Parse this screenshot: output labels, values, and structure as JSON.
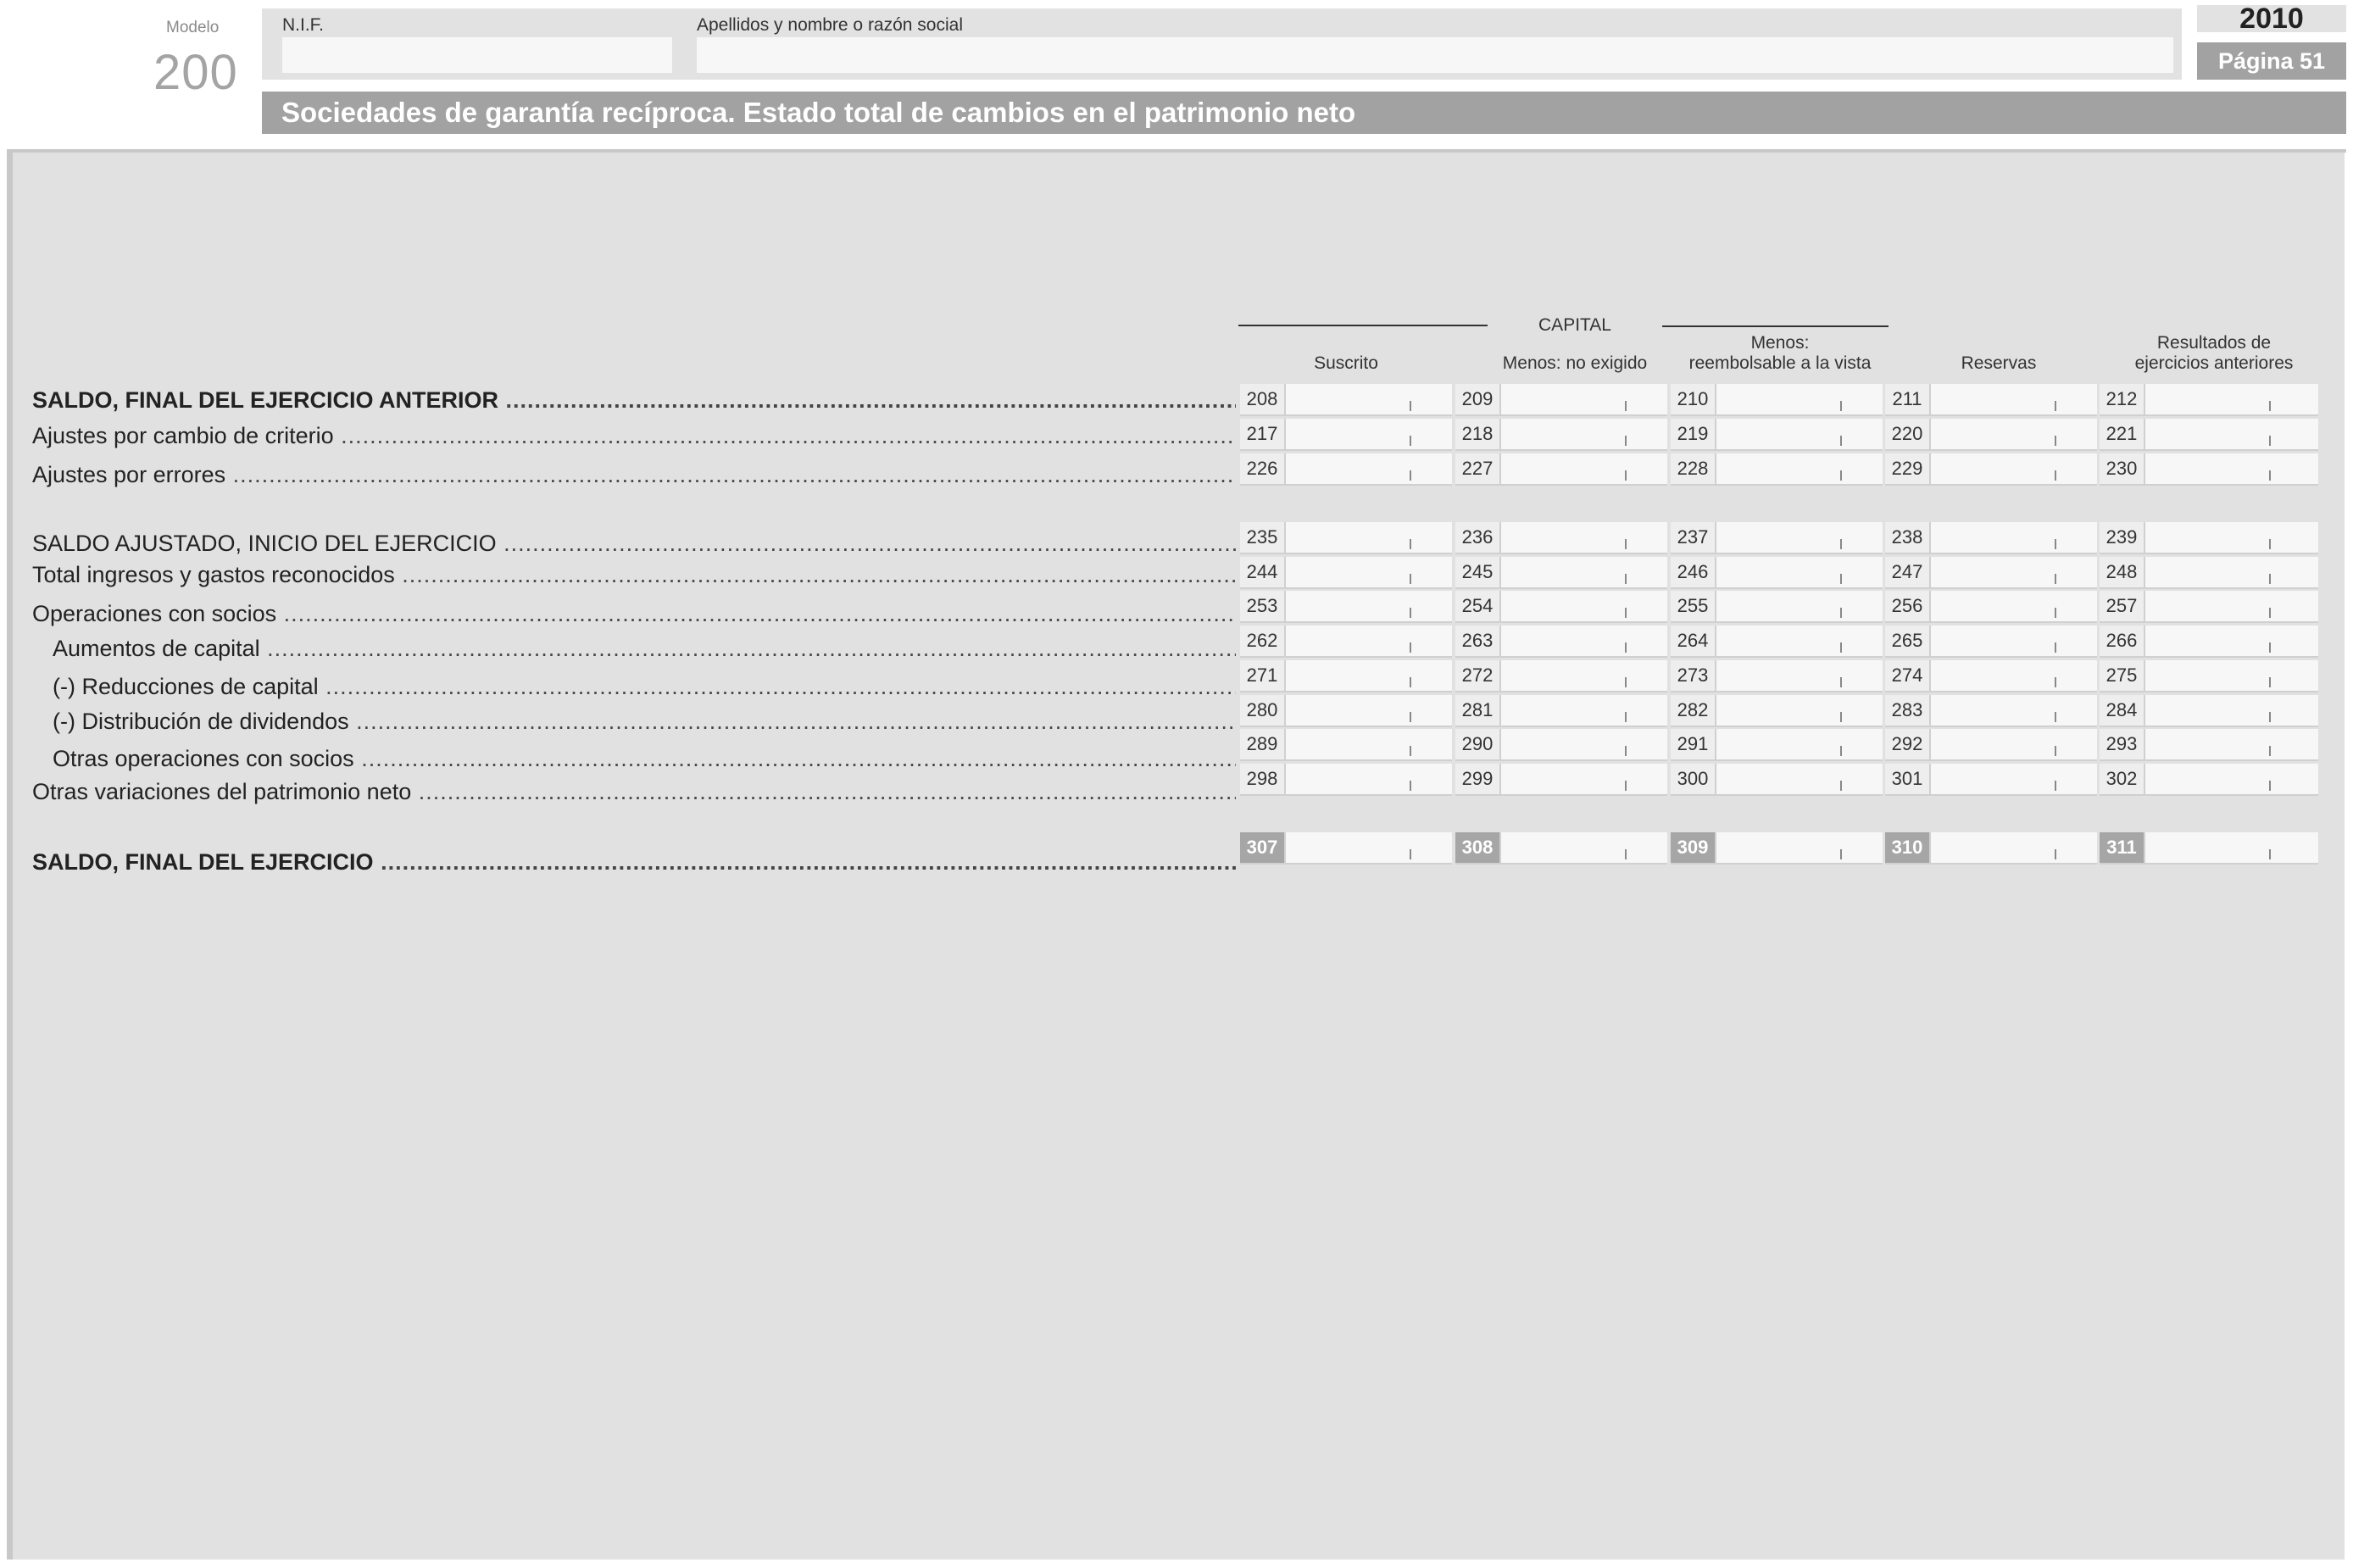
{
  "header": {
    "modelo_label": "Modelo",
    "modelo_number": "200",
    "nif_label": "N.I.F.",
    "nif_value": "",
    "name_label": "Apellidos y nombre o razón social",
    "name_value": "",
    "year": "2010",
    "page": "Página 51",
    "title": "Sociedades de garantía recíproca. Estado total de cambios en el patrimonio neto"
  },
  "columns": {
    "group_label": "CAPITAL",
    "headers": [
      {
        "line1": "",
        "line2": "Suscrito"
      },
      {
        "line1": "",
        "line2": "Menos: no exigido"
      },
      {
        "line1": "Menos:",
        "line2": "reembolsable a la vista"
      },
      {
        "line1": "",
        "line2": "Reservas"
      },
      {
        "line1": "Resultados de",
        "line2": "ejercicios anteriores"
      }
    ]
  },
  "rows": [
    {
      "label": "SALDO, FINAL DEL EJERCICIO ANTERIOR",
      "style": "bold",
      "codes": [
        "208",
        "209",
        "210",
        "211",
        "212"
      ],
      "values": [
        "",
        "",
        "",
        "",
        ""
      ]
    },
    {
      "label": "Ajustes por cambio de criterio",
      "style": "normal",
      "codes": [
        "217",
        "218",
        "219",
        "220",
        "221"
      ],
      "values": [
        "",
        "",
        "",
        "",
        ""
      ]
    },
    {
      "label": "Ajustes por errores",
      "style": "normal",
      "codes": [
        "226",
        "227",
        "228",
        "229",
        "230"
      ],
      "values": [
        "",
        "",
        "",
        "",
        ""
      ]
    },
    {
      "label": "SALDO AJUSTADO, INICIO DEL EJERCICIO",
      "style": "normal",
      "codes": [
        "235",
        "236",
        "237",
        "238",
        "239"
      ],
      "values": [
        "",
        "",
        "",
        "",
        ""
      ]
    },
    {
      "label": "Total ingresos y gastos reconocidos",
      "style": "normal",
      "codes": [
        "244",
        "245",
        "246",
        "247",
        "248"
      ],
      "values": [
        "",
        "",
        "",
        "",
        ""
      ]
    },
    {
      "label": "Operaciones con socios",
      "style": "normal",
      "codes": [
        "253",
        "254",
        "255",
        "256",
        "257"
      ],
      "values": [
        "",
        "",
        "",
        "",
        ""
      ]
    },
    {
      "label": "Aumentos de capital",
      "style": "indent",
      "codes": [
        "262",
        "263",
        "264",
        "265",
        "266"
      ],
      "values": [
        "",
        "",
        "",
        "",
        ""
      ]
    },
    {
      "label": "(-) Reducciones de capital",
      "style": "indent",
      "codes": [
        "271",
        "272",
        "273",
        "274",
        "275"
      ],
      "values": [
        "",
        "",
        "",
        "",
        ""
      ]
    },
    {
      "label": "(-) Distribución de dividendos",
      "style": "indent",
      "codes": [
        "280",
        "281",
        "282",
        "283",
        "284"
      ],
      "values": [
        "",
        "",
        "",
        "",
        ""
      ]
    },
    {
      "label": "Otras operaciones con socios",
      "style": "indent",
      "codes": [
        "289",
        "290",
        "291",
        "292",
        "293"
      ],
      "values": [
        "",
        "",
        "",
        "",
        ""
      ]
    },
    {
      "label": "Otras variaciones del patrimonio neto",
      "style": "normal",
      "codes": [
        "298",
        "299",
        "300",
        "301",
        "302"
      ],
      "values": [
        "",
        "",
        "",
        "",
        ""
      ]
    },
    {
      "label": "SALDO, FINAL DEL EJERCICIO",
      "style": "bold-total",
      "codes": [
        "307",
        "308",
        "309",
        "310",
        "311"
      ],
      "values": [
        "",
        "",
        "",
        "",
        ""
      ]
    }
  ]
}
